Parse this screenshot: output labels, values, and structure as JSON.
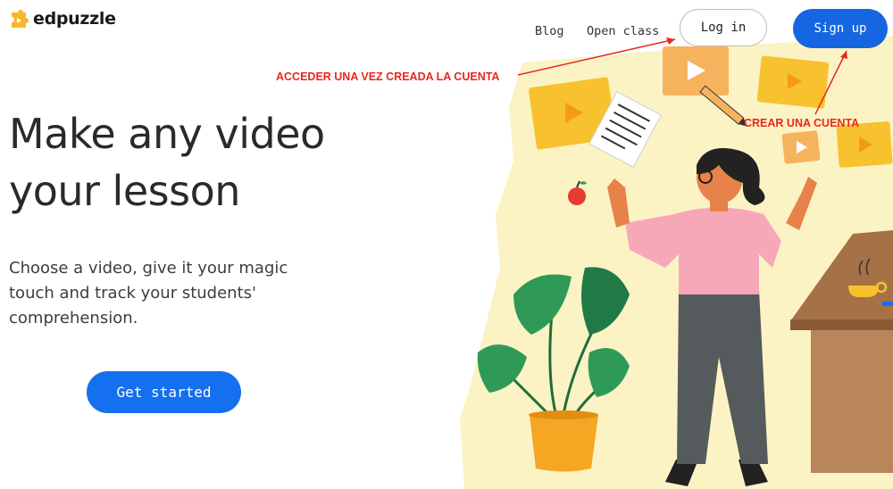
{
  "brand": {
    "name": "edpuzzle"
  },
  "nav": {
    "blog": "Blog",
    "open_class": "Open class",
    "login": "Log in",
    "signup": "Sign up"
  },
  "hero": {
    "title_line1": "Make any video",
    "title_line2": "your lesson",
    "subtitle_line1": "Choose a video, give it your magic",
    "subtitle_line2": "touch and track your students'",
    "subtitle_line3": "comprehension.",
    "cta": "Get started"
  },
  "annotations": {
    "login_note": "ACCEDER UNA VEZ CREADA LA CUENTA",
    "signup_note": "CREAR UNA CUENTA"
  },
  "colors": {
    "brand_yellow": "#f5b82e",
    "primary_blue": "#1566e0",
    "annotation_red": "#e8281e"
  },
  "icons": {
    "logo": "puzzle-piece-logo",
    "video_cards": "play-icon"
  }
}
